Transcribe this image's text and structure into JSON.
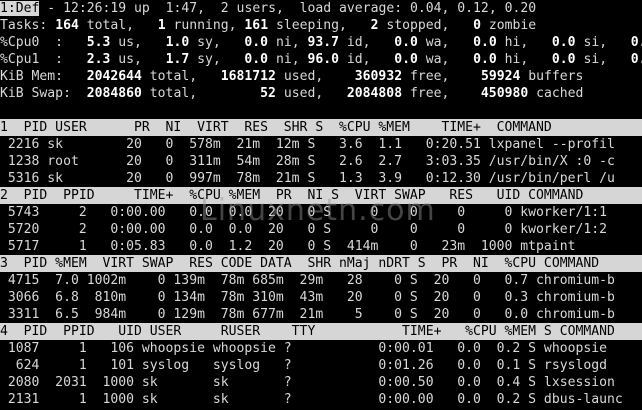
{
  "summary": {
    "window_label": "1:Def",
    "time": "12:26:19",
    "uptime": "1:47",
    "users": "2",
    "load_average": "0.04, 0.12, 0.20",
    "tasks": {
      "total": "164",
      "running": "1",
      "sleeping": "161",
      "stopped": "2",
      "zombie": "0"
    },
    "cpu0": {
      "us": "5.3",
      "sy": "1.0",
      "ni": "0.0",
      "id": "93.7",
      "wa": "0.0",
      "hi": "0.0",
      "si": "0.0"
    },
    "cpu1": {
      "us": "2.3",
      "sy": "1.7",
      "ni": "0.0",
      "id": "96.0",
      "wa": "0.0",
      "hi": "0.0",
      "si": "0.0"
    },
    "mem": {
      "total": "2042644",
      "used": "1681712",
      "free": "360932",
      "buffers": "59924"
    },
    "swap": {
      "total": "2084860",
      "used": "52",
      "free": "2084808",
      "cached": "450980"
    }
  },
  "window1": {
    "header": "1  PID USER      PR  NI  VIRT  RES  SHR S  %CPU %MEM    TIME+  COMMAND",
    "rows": [
      " 2216 sk        20   0  578m  21m  12m S   3.6  1.1   0:20.51 lxpanel --profil",
      " 1238 root      20   0  311m  54m  28m S   2.6  2.7   3:03.35 /usr/bin/X :0 -c",
      " 5316 sk        20   0  997m  78m  21m S   1.3  3.9   0:12.30 /usr/bin/perl /u"
    ]
  },
  "window2": {
    "header": "2  PID  PPID     TIME+  %CPU %MEM  PR  NI S  VIRT SWAP   RES   UID COMMAND",
    "rows": [
      " 5743     2   0:00.00   0.0  0.0  20   0 S     0    0     0     0 kworker/1:1",
      " 5720     2   0:00.00   0.0  0.0  20   0 S     0    0     0     0 kworker/1:2",
      " 5717     1   0:05.83   0.0  1.2  20   0 S  414m    0   23m  1000 mtpaint"
    ]
  },
  "window3": {
    "header": "3  PID %MEM  VIRT SWAP  RES CODE DATA  SHR nMaj nDRT S  PR  NI  %CPU COMMAND",
    "rows": [
      " 4715  7.0 1002m    0 139m  78m 685m  29m   28    0 S  20   0   0.7 chromium-b",
      " 3066  6.8  810m    0 134m  78m 310m  43m   20    0 S  20   0   0.3 chromium-b",
      " 3311  6.5  984m    0 129m  78m 677m  21m    5    0 S  20   0   0.0 chromium-b"
    ]
  },
  "window4": {
    "header": "4  PID  PPID   UID USER     RUSER    TTY           TIME+   %CPU %MEM S COMMAND",
    "rows": [
      " 1087     1   106 whoopsie whoopsie ?           0:00.01   0.0  0.2 S whoopsie",
      "  624     1   101 syslog   syslog   ?           0:01.26   0.0  0.1 S rsyslogd",
      " 2080  2031  1000 sk       sk       ?           0:00.50   0.0  0.4 S lxsession",
      " 2131     1  1000 sk       sk       ?           0:00.00   0.0  0.2 S dbus-launc"
    ]
  },
  "watermark": "Linuxnetn.com"
}
